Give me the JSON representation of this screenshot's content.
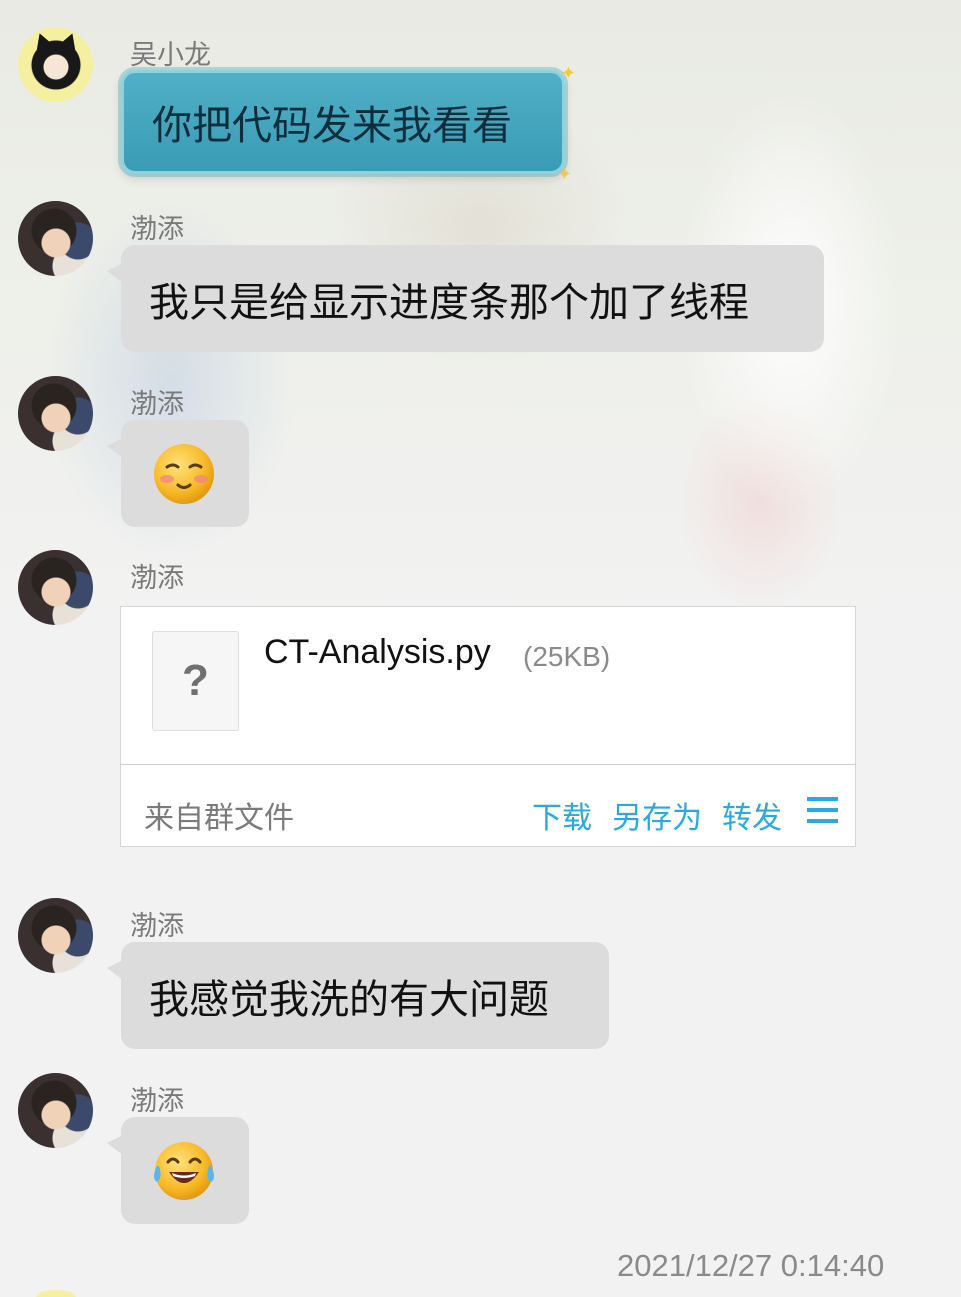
{
  "messages": [
    {
      "sender": "吴小龙",
      "text": "你把代码发来我看看",
      "style": "teal-bubble"
    },
    {
      "sender": "渤添",
      "text": "我只是给显示进度条那个加了线程"
    },
    {
      "sender": "渤添",
      "emoji": "blushing-face-emoji"
    },
    {
      "sender": "渤添",
      "file": {
        "icon_glyph": "?",
        "name": "CT-Analysis.py",
        "size": "(25KB)",
        "source": "来自群文件",
        "actions": [
          "下载",
          "另存为",
          "转发"
        ],
        "menu_icon": "menu-icon"
      }
    },
    {
      "sender": "渤添",
      "text": "我感觉我洗的有大问题"
    },
    {
      "sender": "渤添",
      "emoji": "tears-of-joy-emoji"
    }
  ],
  "timestamp": "2021/12/27 0:14:40",
  "colors": {
    "bubble": "#dcdcdc",
    "teal_bubble": "#3a9bb5",
    "accent": "#2aa8e0",
    "background": "#f2f2f2"
  }
}
